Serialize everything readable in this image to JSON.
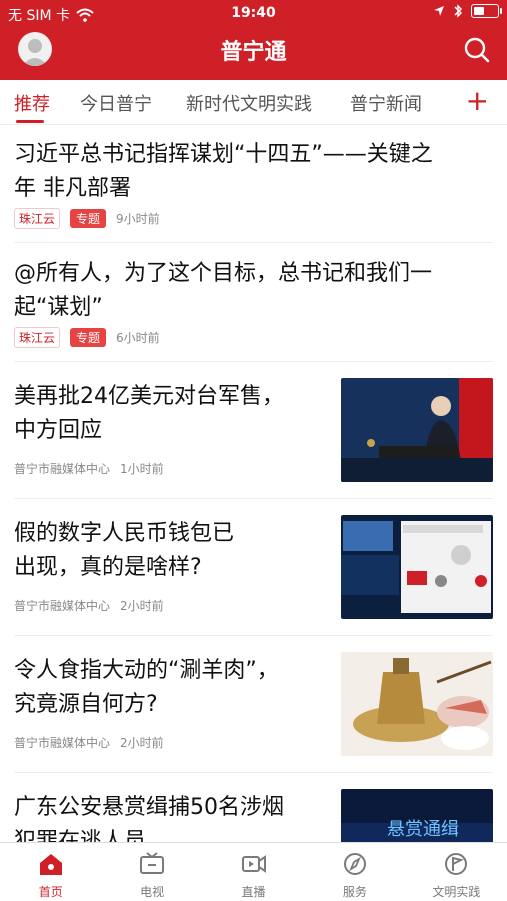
{
  "status": {
    "carrier": "无 SIM 卡",
    "time": "19:40"
  },
  "header": {
    "title": "普宁通"
  },
  "tabs": [
    "推荐",
    "今日普宁",
    "新时代文明实践",
    "普宁新闻"
  ],
  "feed": [
    {
      "title_line1": "习近平总书记指挥谋划“十四五”——关键之",
      "title_line2": "年 非凡部署",
      "source": "珠江云",
      "tag": "专题",
      "time": "9小时前"
    },
    {
      "title_line1": "@所有人，为了这个目标，总书记和我们一",
      "title_line2": "起“谋划”",
      "source": "珠江云",
      "tag": "专题",
      "time": "6小时前"
    },
    {
      "title_line1": "美再批24亿美元对台军售，",
      "title_line2": "中方回应",
      "source": "普宁市融媒体中心",
      "time": "1小时前"
    },
    {
      "title_line1": "假的数字人民币钱包已",
      "title_line2": "出现，真的是啥样?",
      "source": "普宁市融媒体中心",
      "time": "2小时前"
    },
    {
      "title_line1": "令人食指大动的“涮羊肉”，",
      "title_line2": "究竟源自何方?",
      "source": "普宁市融媒体中心",
      "time": "2小时前"
    },
    {
      "title_line1": "广东公安悬赏缉捕50名涉烟",
      "title_line2": "犯罪在逃人员",
      "thumb_text": "悬赏通缉"
    }
  ],
  "bottom_tabs": [
    "首页",
    "电视",
    "直播",
    "服务",
    "文明实践"
  ],
  "colors": {
    "brand": "#cf1f27"
  }
}
